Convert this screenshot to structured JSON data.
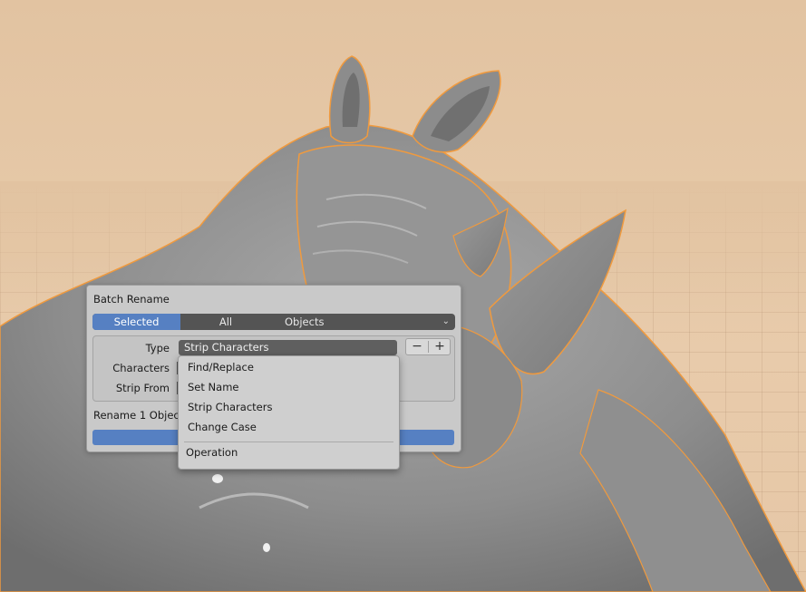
{
  "panel": {
    "title": "Batch Rename",
    "scope": {
      "selected": "Selected",
      "all": "All",
      "data_type": "Objects"
    },
    "type_label": "Type",
    "type_value": "Strip Characters",
    "characters_label": "Characters",
    "strip_from_label": "Strip From",
    "stepper_minus": "−",
    "stepper_plus": "+",
    "status": "Rename 1 Object(s"
  },
  "menu": {
    "items": [
      "Find/Replace",
      "Set Name",
      "Strip Characters",
      "Change Case"
    ],
    "footer": "Operation"
  },
  "colors": {
    "accent": "#5680c2",
    "panel_bg": "#c9c9c9",
    "viewport_bg": "#e2c3a1",
    "model": "#8f8f8f",
    "outline": "#f09a3e"
  },
  "icons": {
    "dropdown_chevron": "chevron-down-icon"
  }
}
